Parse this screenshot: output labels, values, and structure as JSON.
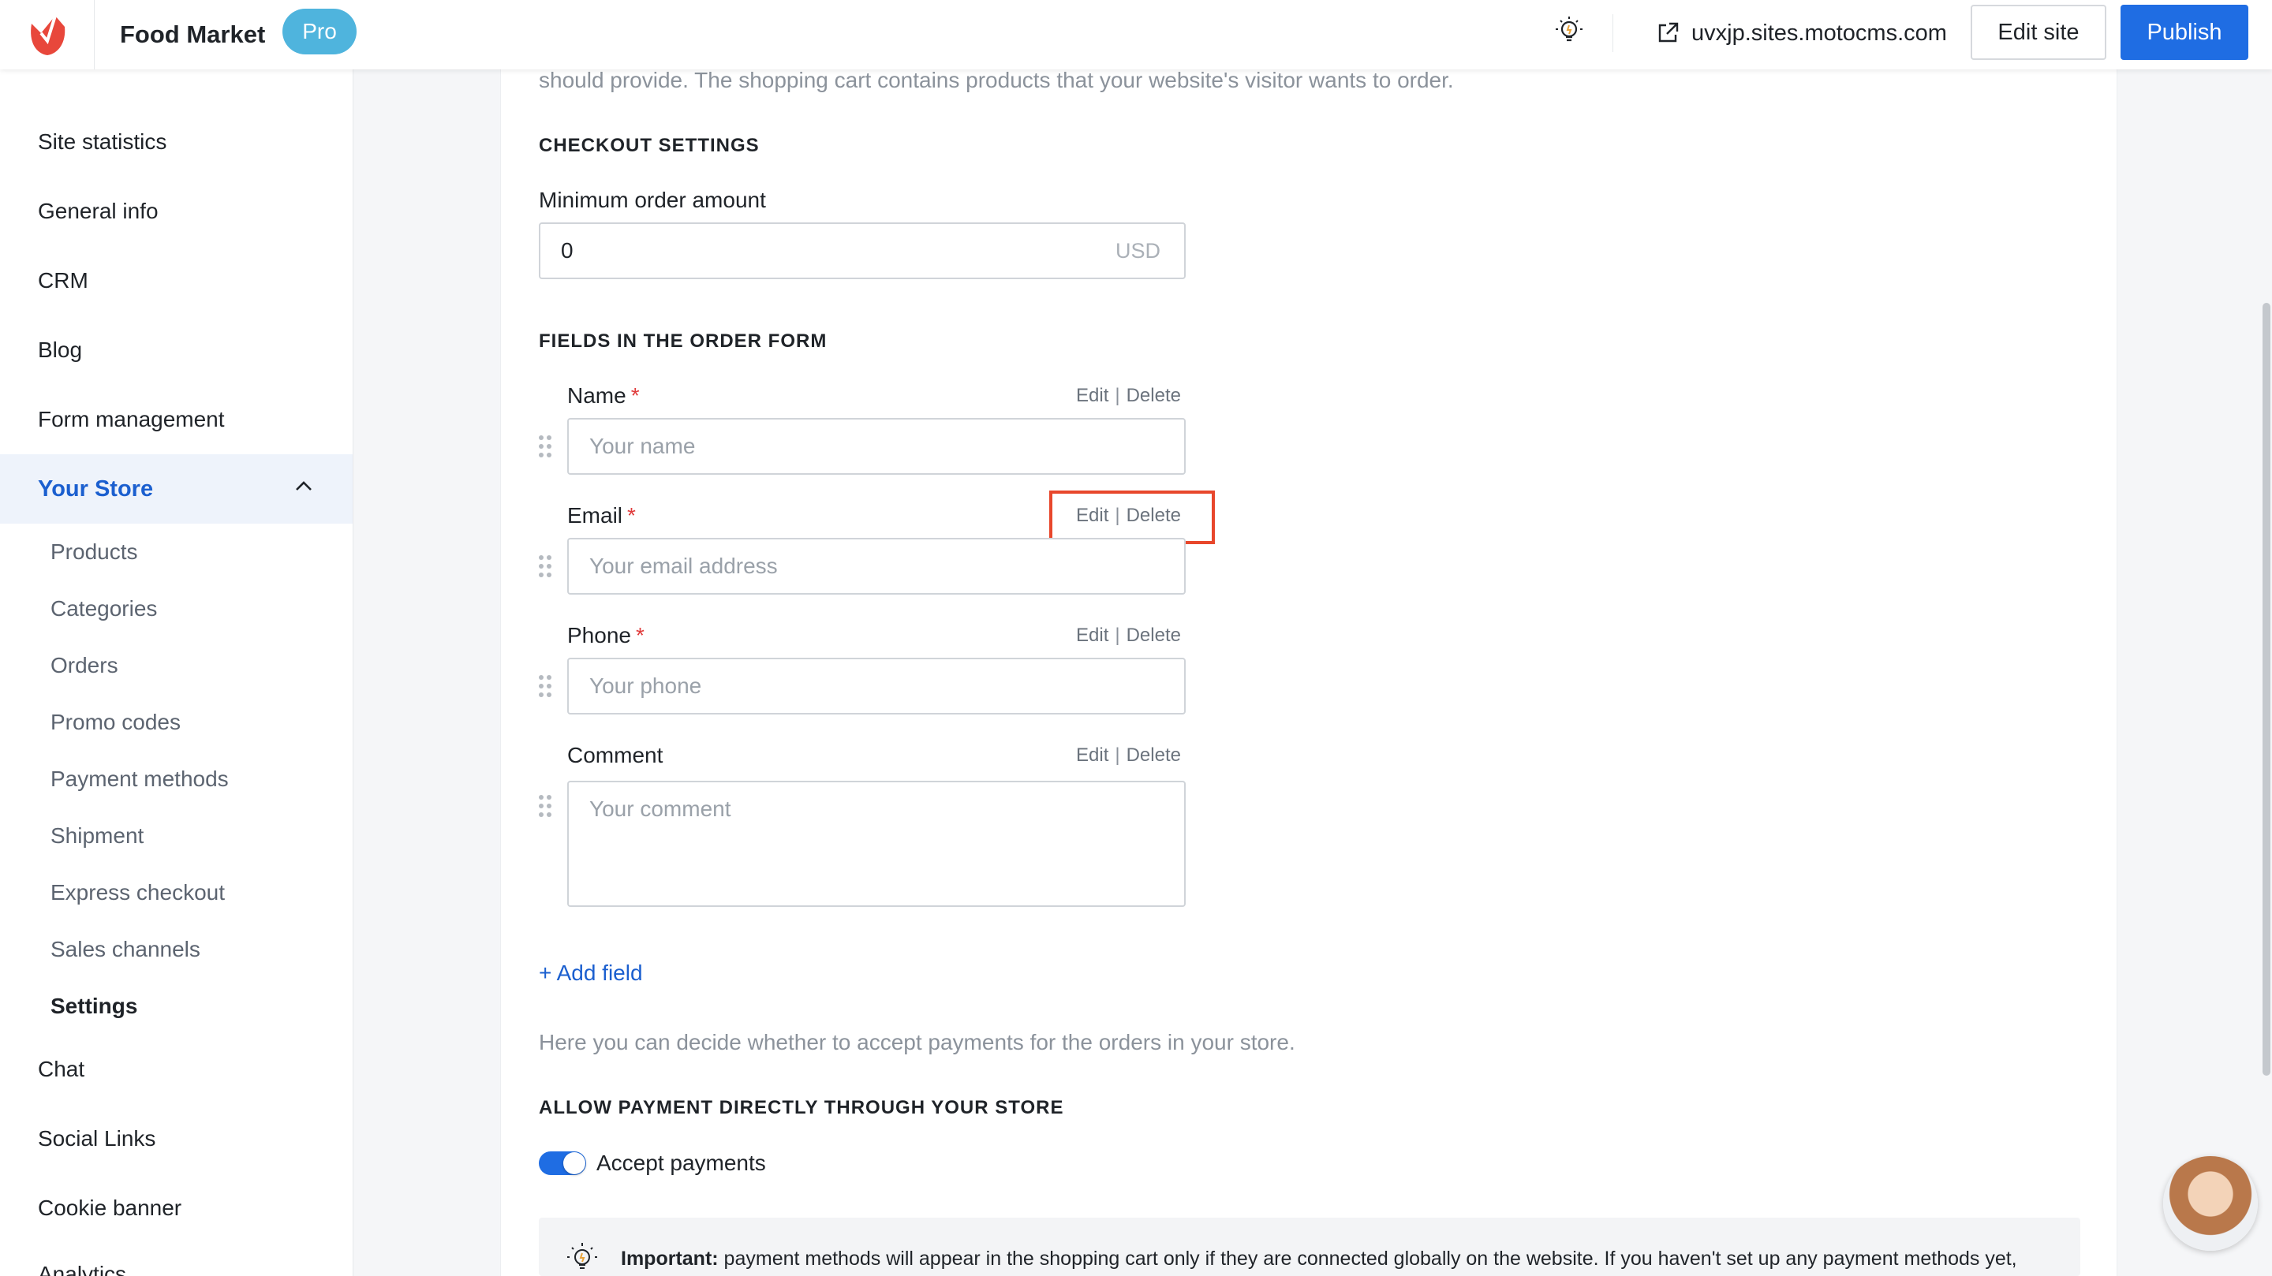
{
  "header": {
    "app_title": "Food Market",
    "badge": "Pro",
    "site_url": "uvxjp.sites.motocms.com",
    "edit_site_label": "Edit site",
    "publish_label": "Publish"
  },
  "sidebar": {
    "items": [
      {
        "label": "Site statistics"
      },
      {
        "label": "General info"
      },
      {
        "label": "CRM"
      },
      {
        "label": "Blog"
      },
      {
        "label": "Form management"
      }
    ],
    "active": {
      "label": "Your Store"
    },
    "sub_items": [
      {
        "label": "Products"
      },
      {
        "label": "Categories"
      },
      {
        "label": "Orders"
      },
      {
        "label": "Promo codes"
      },
      {
        "label": "Payment methods"
      },
      {
        "label": "Shipment"
      },
      {
        "label": "Express checkout"
      },
      {
        "label": "Sales channels"
      },
      {
        "label": "Settings"
      }
    ],
    "after_items": [
      {
        "label": "Chat"
      },
      {
        "label": "Social Links"
      },
      {
        "label": "Cookie banner"
      },
      {
        "label": "Analytics"
      }
    ]
  },
  "main": {
    "intro_text": "should provide. The shopping cart contains products that your website's visitor wants to order.",
    "checkout": {
      "heading": "CHECKOUT SETTINGS",
      "min_order_label": "Minimum order amount",
      "min_order_value": "0",
      "currency": "USD"
    },
    "order_form": {
      "heading": "FIELDS IN THE ORDER FORM",
      "edit_label": "Edit",
      "separator": "|",
      "delete_label": "Delete",
      "required_mark": "*",
      "fields": [
        {
          "label": "Name",
          "placeholder": "Your name"
        },
        {
          "label": "Email",
          "placeholder": "Your email address"
        },
        {
          "label": "Phone",
          "placeholder": "Your phone"
        },
        {
          "label": "Comment",
          "placeholder": "Your comment"
        }
      ],
      "add_field_label": "+ Add field"
    },
    "payments": {
      "info_text": "Here you can decide whether to accept payments for the orders in your store.",
      "heading": "ALLOW PAYMENT DIRECTLY THROUGH YOUR STORE",
      "toggle_label": "Accept payments",
      "toggle_on": true,
      "notice_strong": "Important:",
      "notice_text": " payment methods will appear in the shopping cart only if they are connected globally on the website. If you haven't set up any payment methods yet,"
    }
  },
  "colors": {
    "accent": "#1f6de3",
    "active_nav": "#1b5fcf",
    "badge": "#4fb4dd",
    "highlight": "#e8472c",
    "required": "#e03c3c"
  }
}
